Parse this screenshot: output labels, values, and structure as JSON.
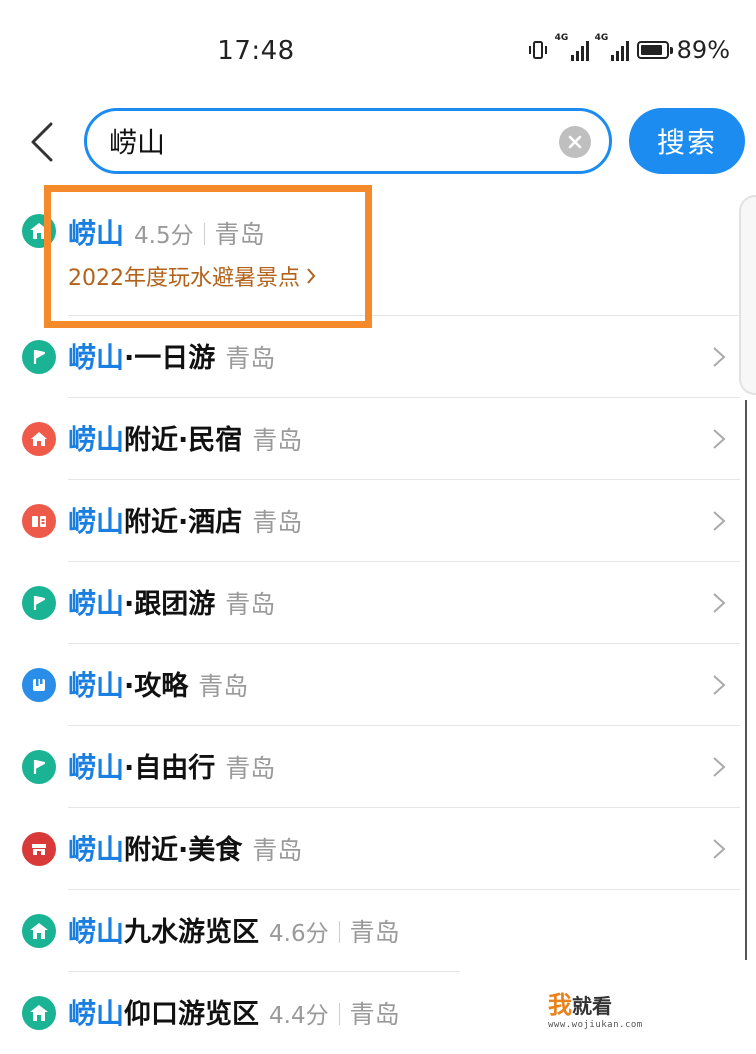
{
  "status_bar": {
    "time": "17:48",
    "network_1": "4G",
    "network_2": "4G",
    "battery_percent": "89%",
    "battery_level": 0.89
  },
  "search": {
    "query": "崂山",
    "button_label": "搜索"
  },
  "colors": {
    "accent": "#1d8cf0",
    "keyword": "#1a7fe0",
    "promo": "#b2621b",
    "highlight": "#f58a2a",
    "icon_scenic": "#1ab394",
    "icon_route": "#1ab394",
    "icon_homestay": "#f05a4a",
    "icon_hotel": "#ee5a4a",
    "icon_guide": "#2a8de8",
    "icon_food": "#d83a3a"
  },
  "suggestions": [
    {
      "icon": "scenic-spot-icon",
      "keyword": "崂山",
      "rest": "",
      "score": "4.5分",
      "city": "青岛",
      "promo": "2022年度玩水避暑景点"
    },
    {
      "icon": "flag-icon",
      "keyword": "崂山",
      "rest": "·一日游",
      "city": "青岛"
    },
    {
      "icon": "house-icon",
      "keyword": "崂山",
      "rest": "附近·民宿",
      "city": "青岛"
    },
    {
      "icon": "hotel-icon",
      "keyword": "崂山",
      "rest": "附近·酒店",
      "city": "青岛"
    },
    {
      "icon": "flag-icon",
      "keyword": "崂山",
      "rest": "·跟团游",
      "city": "青岛"
    },
    {
      "icon": "guide-book-icon",
      "keyword": "崂山",
      "rest": "·攻略",
      "city": "青岛"
    },
    {
      "icon": "flag-icon",
      "keyword": "崂山",
      "rest": "·自由行",
      "city": "青岛"
    },
    {
      "icon": "food-store-icon",
      "keyword": "崂山",
      "rest": "附近·美食",
      "city": "青岛"
    },
    {
      "icon": "scenic-spot-icon",
      "keyword": "崂山",
      "rest": "九水游览区",
      "score": "4.6分",
      "city": "青岛"
    },
    {
      "icon": "scenic-spot-icon",
      "keyword": "崂山",
      "rest": "仰口游览区",
      "score": "4.4分",
      "city": "青岛"
    }
  ],
  "watermark": {
    "accent": "我",
    "text": "就看",
    "url": "www.wojiukan.com"
  }
}
